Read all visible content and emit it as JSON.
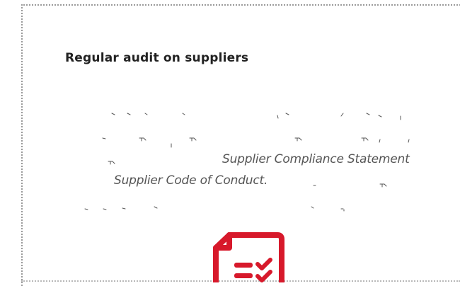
{
  "section": {
    "title": "Regular audit on suppliers",
    "phrase_statement": "Supplier Compliance Statement",
    "phrase_code": "Supplier Code of Conduct."
  },
  "icons": {
    "checklist": "checklist-document-icon",
    "accent_color": "#d7192b"
  }
}
